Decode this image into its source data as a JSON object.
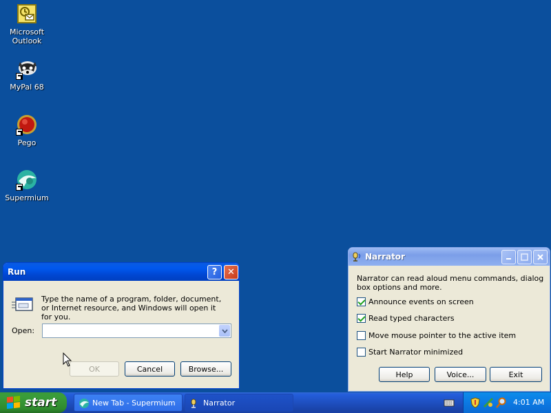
{
  "desktop": {
    "icons": [
      {
        "label_line1": "Microsoft",
        "label_line2": "Outlook",
        "icon": "outlook-icon"
      },
      {
        "label": "MyPal 68",
        "icon": "mypal-icon"
      },
      {
        "label": "Pego",
        "icon": "pego-icon"
      },
      {
        "label": "Supermium",
        "icon": "supermium-icon"
      }
    ]
  },
  "run_dialog": {
    "title": "Run",
    "help_label": "?",
    "close_label": "✕",
    "description": "Type the name of a program, folder, document, or Internet resource, and Windows will open it for you.",
    "open_label": "Open:",
    "open_value": "",
    "buttons": {
      "ok": "OK",
      "cancel": "Cancel",
      "browse": "Browse..."
    }
  },
  "narrator": {
    "title": "Narrator",
    "description": "Narrator can read aloud menu commands, dialog box options and more.",
    "options": [
      {
        "label": "Announce events on screen",
        "checked": true
      },
      {
        "label": "Read typed characters",
        "checked": true
      },
      {
        "label": "Move mouse pointer to the active item",
        "checked": false
      },
      {
        "label": "Start Narrator minimized",
        "checked": false
      }
    ],
    "buttons": {
      "help": "Help",
      "voice": "Voice...",
      "exit": "Exit"
    }
  },
  "taskbar": {
    "start_label": "start",
    "tasks": [
      {
        "label": "New Tab - Supermium",
        "icon": "supermium-icon"
      },
      {
        "label": "Narrator",
        "icon": "narrator-icon"
      }
    ],
    "clock": "4:01 AM"
  },
  "colors": {
    "desktop": "#0b4f9d",
    "title_active": "#0058ee",
    "taskbar": "#245edb",
    "start": "#3a9d3a"
  }
}
